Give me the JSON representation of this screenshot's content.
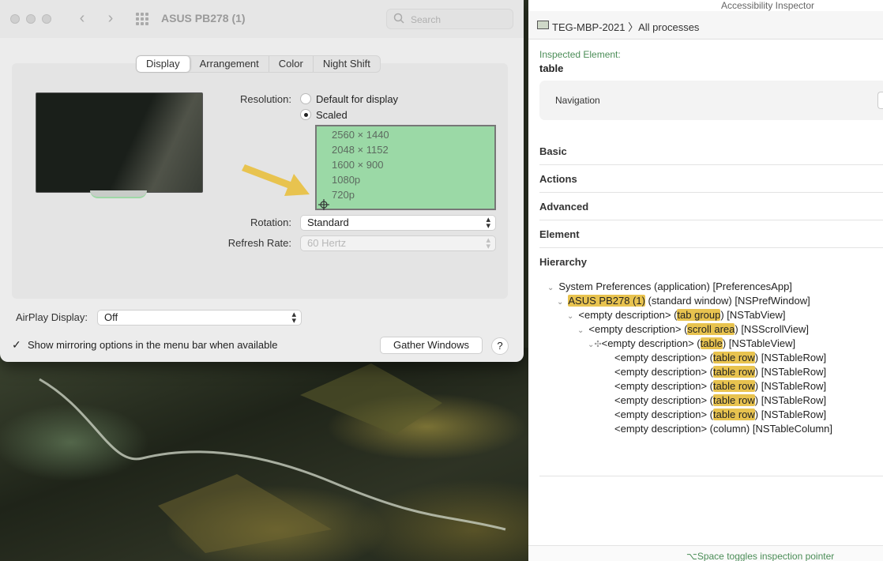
{
  "system_preferences": {
    "title": "ASUS PB278 (1)",
    "search_placeholder": "Search",
    "tabs": [
      "Display",
      "Arrangement",
      "Color",
      "Night Shift"
    ],
    "active_tab": "Display",
    "resolution": {
      "label": "Resolution:",
      "options": [
        "Default for display",
        "Scaled"
      ],
      "selected": "Scaled",
      "scaled_list": [
        "2560 × 1440",
        "2048 × 1152",
        "1600 × 900",
        "1080p",
        "720p"
      ]
    },
    "rotation": {
      "label": "Rotation:",
      "value": "Standard"
    },
    "refresh_rate": {
      "label": "Refresh Rate:",
      "value": "60 Hertz"
    },
    "airplay": {
      "label": "AirPlay Display:",
      "value": "Off"
    },
    "mirroring_checkbox": {
      "label": "Show mirroring options in the menu bar when available",
      "checked": true
    },
    "gather_windows_label": "Gather Windows",
    "help_label": "?"
  },
  "accessibility_inspector": {
    "title": "Accessibility Inspector",
    "breadcrumb": {
      "host": "TEG-MBP-2021",
      "separator": "〉",
      "target": "All processes"
    },
    "inspected_label": "Inspected Element:",
    "inspected_value": "table",
    "navigation_label": "Navigation",
    "sections": [
      "Basic",
      "Actions",
      "Advanced",
      "Element",
      "Hierarchy"
    ],
    "hierarchy": {
      "r0": {
        "text": "System Preferences (application) [PreferencesApp]"
      },
      "r1": {
        "hl": "ASUS PB278 (1)",
        "after": " (standard window) [NSPrefWindow]"
      },
      "r2": {
        "before": "<empty description> (",
        "hl": "tab group",
        "after": ") [NSTabView]"
      },
      "r3": {
        "before": "<empty description> (",
        "hl": "scroll area",
        "after": ") [NSScrollView]"
      },
      "r4": {
        "before": "<empty description> (",
        "hl": "table",
        "after": ") [NSTableView]"
      },
      "rows": [
        {
          "before": "<empty description> (",
          "hl": "table row",
          "after": ") [NSTableRow]"
        },
        {
          "before": "<empty description> (",
          "hl": "table row",
          "after": ") [NSTableRow]"
        },
        {
          "before": "<empty description> (",
          "hl": "table row",
          "after": ") [NSTableRow]"
        },
        {
          "before": "<empty description> (",
          "hl": "table row",
          "after": ") [NSTableRow]"
        },
        {
          "before": "<empty description> (",
          "hl": "table row",
          "after": ") [NSTableRow]"
        }
      ],
      "column": {
        "text": "<empty description> (column) [NSTableColumn]"
      }
    },
    "footer_hint": "⌥Space toggles inspection pointer"
  },
  "colors": {
    "scaled_list_bg": "#9bd9a6",
    "highlight": "#e8c34f",
    "arrow": "#e8c34f",
    "accent_green": "#4b8d57"
  }
}
